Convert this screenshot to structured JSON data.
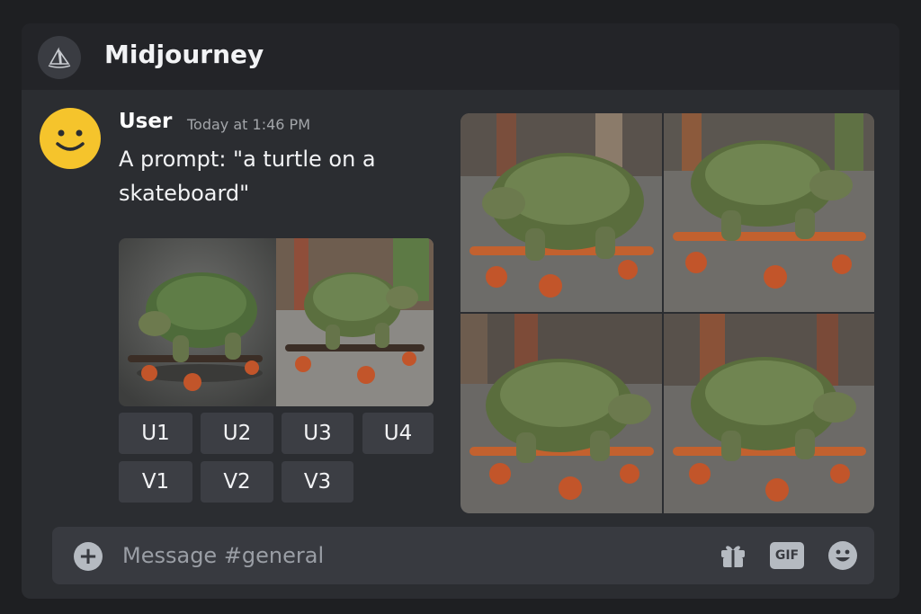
{
  "header": {
    "title": "Midjourney",
    "server_icon": "sailboat-logo-icon"
  },
  "message": {
    "username": "User",
    "timestamp": "Today at 1:46 PM",
    "text": "A prompt: \"a turtle on a skateboard\"",
    "avatar": "smiley-face-icon"
  },
  "buttons": {
    "u1": "U1",
    "u2": "U2",
    "u3": "U3",
    "u4": "U4",
    "v1": "V1",
    "v2": "V2",
    "v3": "V3"
  },
  "composer": {
    "placeholder": "Message #general",
    "gif_label": "GIF",
    "icons": [
      "plus-circle-icon",
      "gift-icon",
      "gif-icon",
      "emoji-icon"
    ]
  },
  "colors": {
    "background": "#1e1f22",
    "panel": "#2b2d31",
    "header": "#232428",
    "button": "#3c3e44",
    "avatar": "#f5c42c",
    "composer": "#383a40"
  }
}
